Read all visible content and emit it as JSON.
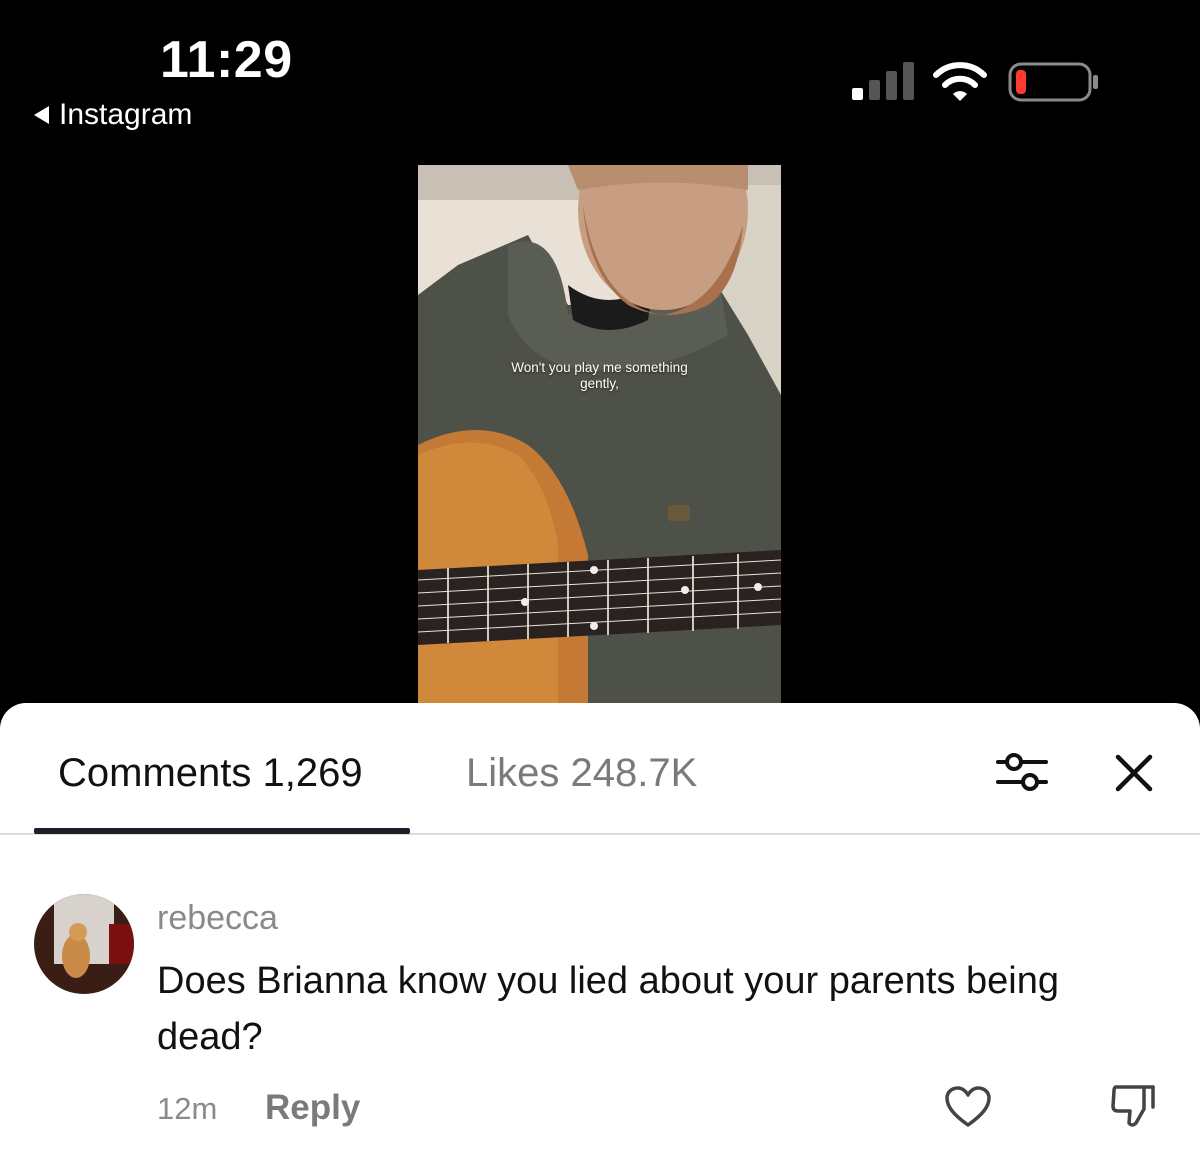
{
  "status_bar": {
    "time": "11:29",
    "back_app": "Instagram",
    "battery_color": "#ff3b30"
  },
  "video": {
    "caption_line1": "Won't you play me something",
    "caption_line2": "gently,"
  },
  "comments_sheet": {
    "tabs": [
      {
        "label": "Comments 1,269",
        "active": true
      },
      {
        "label": "Likes 248.7K",
        "active": false
      }
    ],
    "accent_color": "#1e1e2a",
    "comment": {
      "username": "rebecca",
      "text": "Does Brianna know you lied about your parents being dead?",
      "time": "12m",
      "reply_label": "Reply"
    }
  },
  "icons": [
    "back-arrow-icon",
    "signal-icon",
    "wifi-icon",
    "battery-icon",
    "filter-icon",
    "close-icon",
    "heart-icon",
    "dislike-icon"
  ]
}
